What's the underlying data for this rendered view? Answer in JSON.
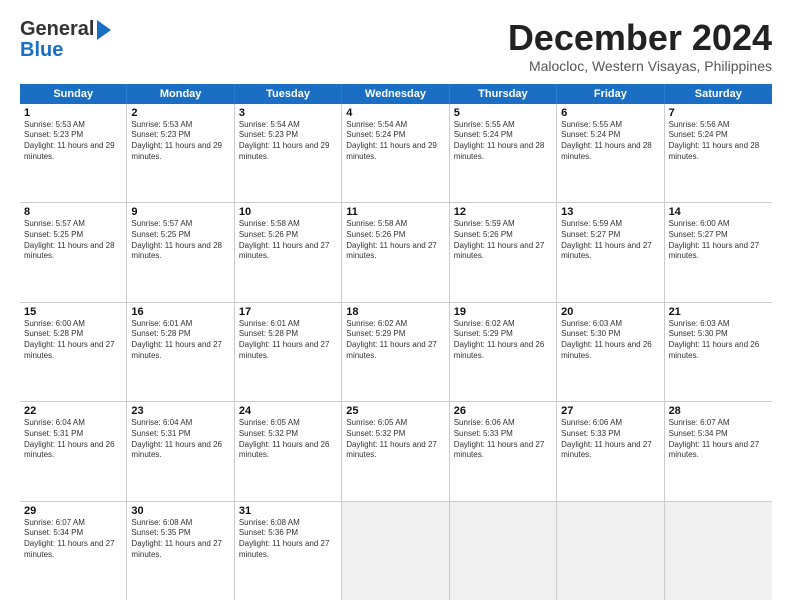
{
  "header": {
    "logo_general": "General",
    "logo_blue": "Blue",
    "title": "December 2024",
    "subtitle": "Malocloc, Western Visayas, Philippines"
  },
  "weekdays": [
    "Sunday",
    "Monday",
    "Tuesday",
    "Wednesday",
    "Thursday",
    "Friday",
    "Saturday"
  ],
  "rows": [
    [
      {
        "day": "1",
        "sunrise": "5:53 AM",
        "sunset": "5:23 PM",
        "daylight": "11 hours and 29 minutes."
      },
      {
        "day": "2",
        "sunrise": "5:53 AM",
        "sunset": "5:23 PM",
        "daylight": "11 hours and 29 minutes."
      },
      {
        "day": "3",
        "sunrise": "5:54 AM",
        "sunset": "5:23 PM",
        "daylight": "11 hours and 29 minutes."
      },
      {
        "day": "4",
        "sunrise": "5:54 AM",
        "sunset": "5:24 PM",
        "daylight": "11 hours and 29 minutes."
      },
      {
        "day": "5",
        "sunrise": "5:55 AM",
        "sunset": "5:24 PM",
        "daylight": "11 hours and 28 minutes."
      },
      {
        "day": "6",
        "sunrise": "5:55 AM",
        "sunset": "5:24 PM",
        "daylight": "11 hours and 28 minutes."
      },
      {
        "day": "7",
        "sunrise": "5:56 AM",
        "sunset": "5:24 PM",
        "daylight": "11 hours and 28 minutes."
      }
    ],
    [
      {
        "day": "8",
        "sunrise": "5:57 AM",
        "sunset": "5:25 PM",
        "daylight": "11 hours and 28 minutes."
      },
      {
        "day": "9",
        "sunrise": "5:57 AM",
        "sunset": "5:25 PM",
        "daylight": "11 hours and 28 minutes."
      },
      {
        "day": "10",
        "sunrise": "5:58 AM",
        "sunset": "5:26 PM",
        "daylight": "11 hours and 27 minutes."
      },
      {
        "day": "11",
        "sunrise": "5:58 AM",
        "sunset": "5:26 PM",
        "daylight": "11 hours and 27 minutes."
      },
      {
        "day": "12",
        "sunrise": "5:59 AM",
        "sunset": "5:26 PM",
        "daylight": "11 hours and 27 minutes."
      },
      {
        "day": "13",
        "sunrise": "5:59 AM",
        "sunset": "5:27 PM",
        "daylight": "11 hours and 27 minutes."
      },
      {
        "day": "14",
        "sunrise": "6:00 AM",
        "sunset": "5:27 PM",
        "daylight": "11 hours and 27 minutes."
      }
    ],
    [
      {
        "day": "15",
        "sunrise": "6:00 AM",
        "sunset": "5:28 PM",
        "daylight": "11 hours and 27 minutes."
      },
      {
        "day": "16",
        "sunrise": "6:01 AM",
        "sunset": "5:28 PM",
        "daylight": "11 hours and 27 minutes."
      },
      {
        "day": "17",
        "sunrise": "6:01 AM",
        "sunset": "5:28 PM",
        "daylight": "11 hours and 27 minutes."
      },
      {
        "day": "18",
        "sunrise": "6:02 AM",
        "sunset": "5:29 PM",
        "daylight": "11 hours and 27 minutes."
      },
      {
        "day": "19",
        "sunrise": "6:02 AM",
        "sunset": "5:29 PM",
        "daylight": "11 hours and 26 minutes."
      },
      {
        "day": "20",
        "sunrise": "6:03 AM",
        "sunset": "5:30 PM",
        "daylight": "11 hours and 26 minutes."
      },
      {
        "day": "21",
        "sunrise": "6:03 AM",
        "sunset": "5:30 PM",
        "daylight": "11 hours and 26 minutes."
      }
    ],
    [
      {
        "day": "22",
        "sunrise": "6:04 AM",
        "sunset": "5:31 PM",
        "daylight": "11 hours and 26 minutes."
      },
      {
        "day": "23",
        "sunrise": "6:04 AM",
        "sunset": "5:31 PM",
        "daylight": "11 hours and 26 minutes."
      },
      {
        "day": "24",
        "sunrise": "6:05 AM",
        "sunset": "5:32 PM",
        "daylight": "11 hours and 26 minutes."
      },
      {
        "day": "25",
        "sunrise": "6:05 AM",
        "sunset": "5:32 PM",
        "daylight": "11 hours and 27 minutes."
      },
      {
        "day": "26",
        "sunrise": "6:06 AM",
        "sunset": "5:33 PM",
        "daylight": "11 hours and 27 minutes."
      },
      {
        "day": "27",
        "sunrise": "6:06 AM",
        "sunset": "5:33 PM",
        "daylight": "11 hours and 27 minutes."
      },
      {
        "day": "28",
        "sunrise": "6:07 AM",
        "sunset": "5:34 PM",
        "daylight": "11 hours and 27 minutes."
      }
    ],
    [
      {
        "day": "29",
        "sunrise": "6:07 AM",
        "sunset": "5:34 PM",
        "daylight": "11 hours and 27 minutes."
      },
      {
        "day": "30",
        "sunrise": "6:08 AM",
        "sunset": "5:35 PM",
        "daylight": "11 hours and 27 minutes."
      },
      {
        "day": "31",
        "sunrise": "6:08 AM",
        "sunset": "5:36 PM",
        "daylight": "11 hours and 27 minutes."
      },
      null,
      null,
      null,
      null
    ]
  ],
  "labels": {
    "sunrise": "Sunrise:",
    "sunset": "Sunset:",
    "daylight": "Daylight:"
  }
}
